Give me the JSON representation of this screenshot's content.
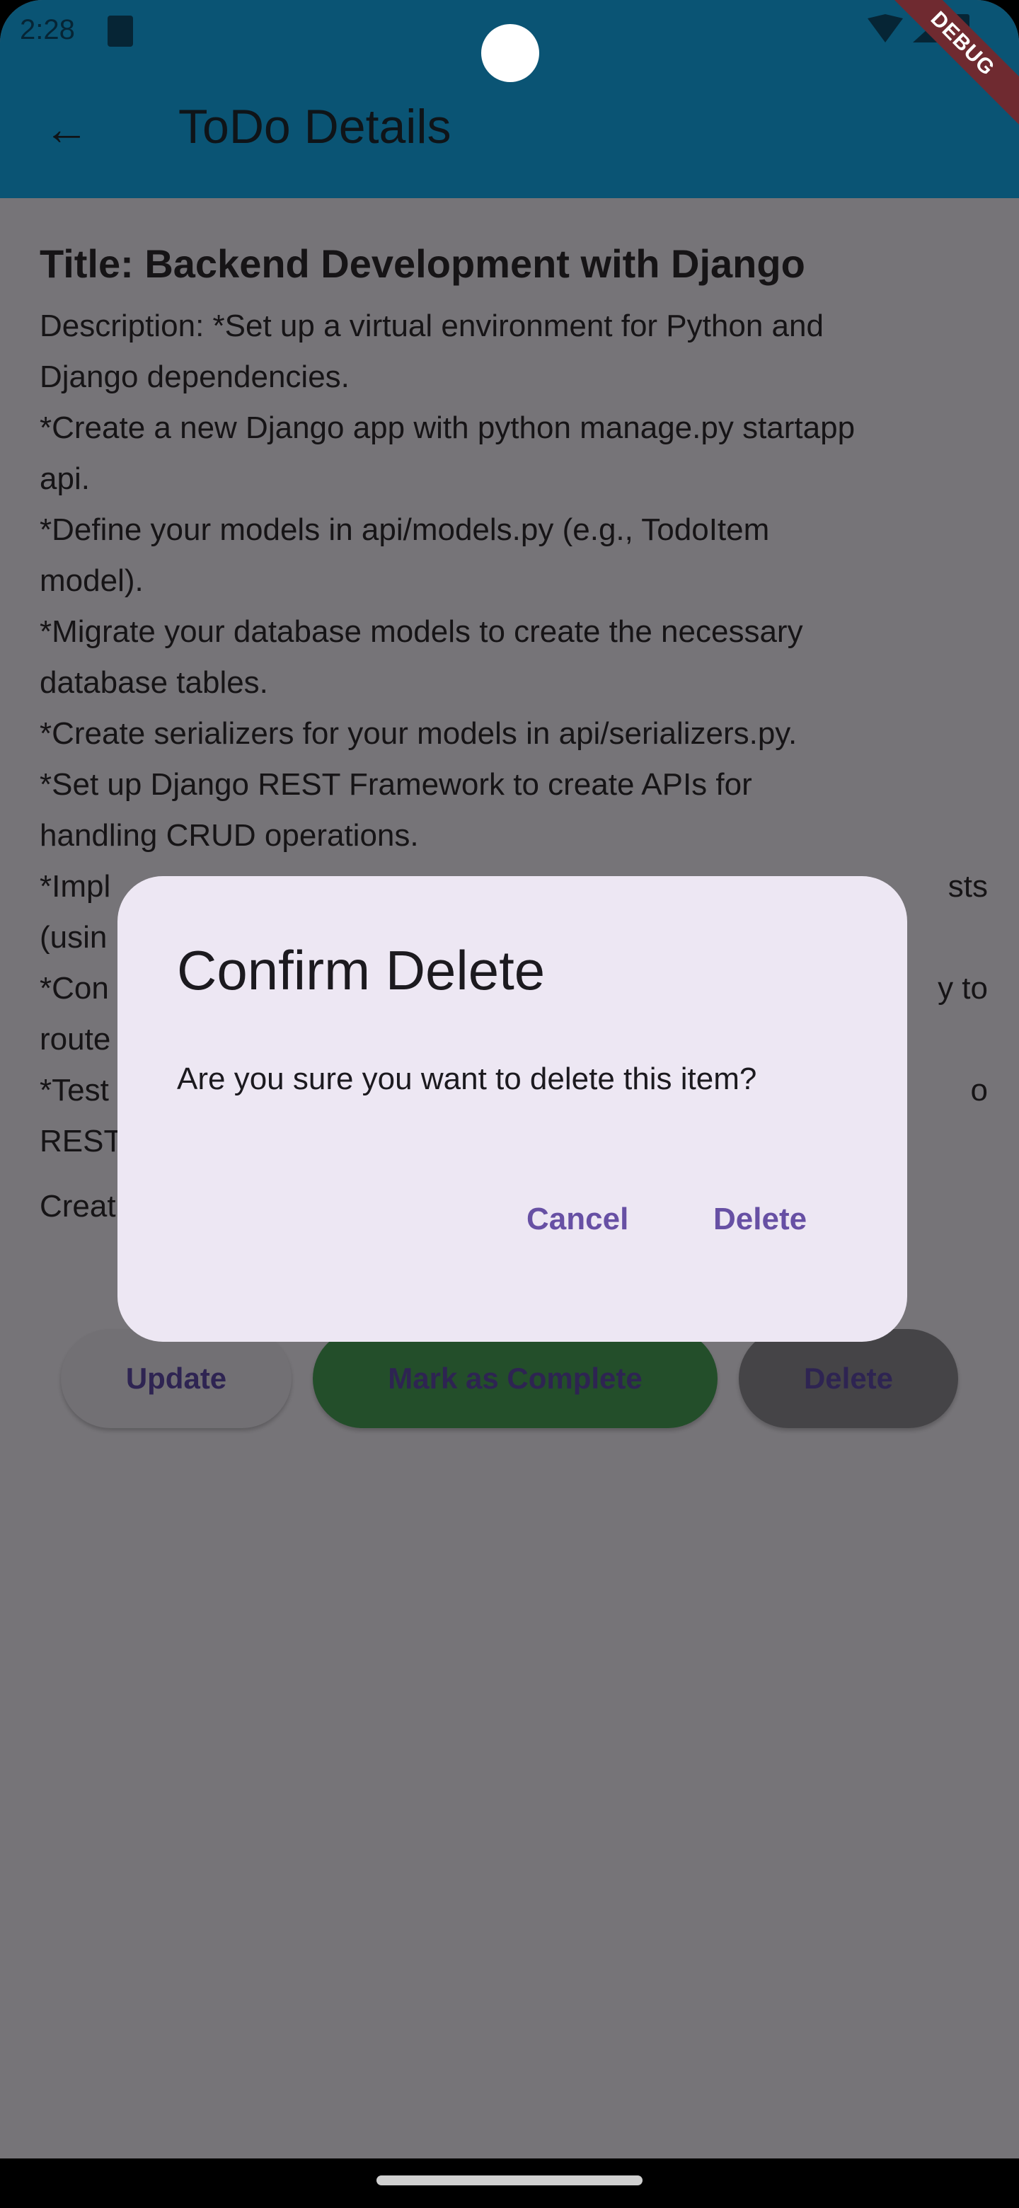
{
  "status_bar": {
    "time": "2:28"
  },
  "app_bar": {
    "title": "ToDo Details",
    "debug_banner": "DEBUG"
  },
  "todo": {
    "title": "Title: Backend Development with Django",
    "description_lines": [
      {
        "left": "Description: *Set up a virtual environment for Python and",
        "right": ""
      },
      {
        "left": "Django dependencies.",
        "right": ""
      },
      {
        "left": "*Create a new Django app with python manage.py startapp",
        "right": ""
      },
      {
        "left": "api.",
        "right": ""
      },
      {
        "left": "*Define your models in api/models.py (e.g., TodoItem",
        "right": ""
      },
      {
        "left": "model).",
        "right": ""
      },
      {
        "left": "*Migrate your database models to create the necessary",
        "right": ""
      },
      {
        "left": "database tables.",
        "right": ""
      },
      {
        "left": "*Create serializers for your models in api/serializers.py.",
        "right": ""
      },
      {
        "left": "*Set up Django REST Framework to create APIs for",
        "right": ""
      },
      {
        "left": "handling CRUD operations.",
        "right": ""
      },
      {
        "left": "*Impl",
        "right": "sts"
      },
      {
        "left": "(usin",
        "right": ""
      },
      {
        "left": "*Con",
        "right": "y to"
      },
      {
        "left": "route",
        "right": ""
      },
      {
        "left": "*Test",
        "right": "o"
      },
      {
        "left": "REST",
        "right": ""
      }
    ],
    "created_partial": "Creat"
  },
  "actions": {
    "update": "Update",
    "complete": "Mark as Complete",
    "delete": "Delete"
  },
  "dialog": {
    "title": "Confirm Delete",
    "message": "Are you sure you want to delete this item?",
    "cancel": "Cancel",
    "confirm": "Delete"
  }
}
